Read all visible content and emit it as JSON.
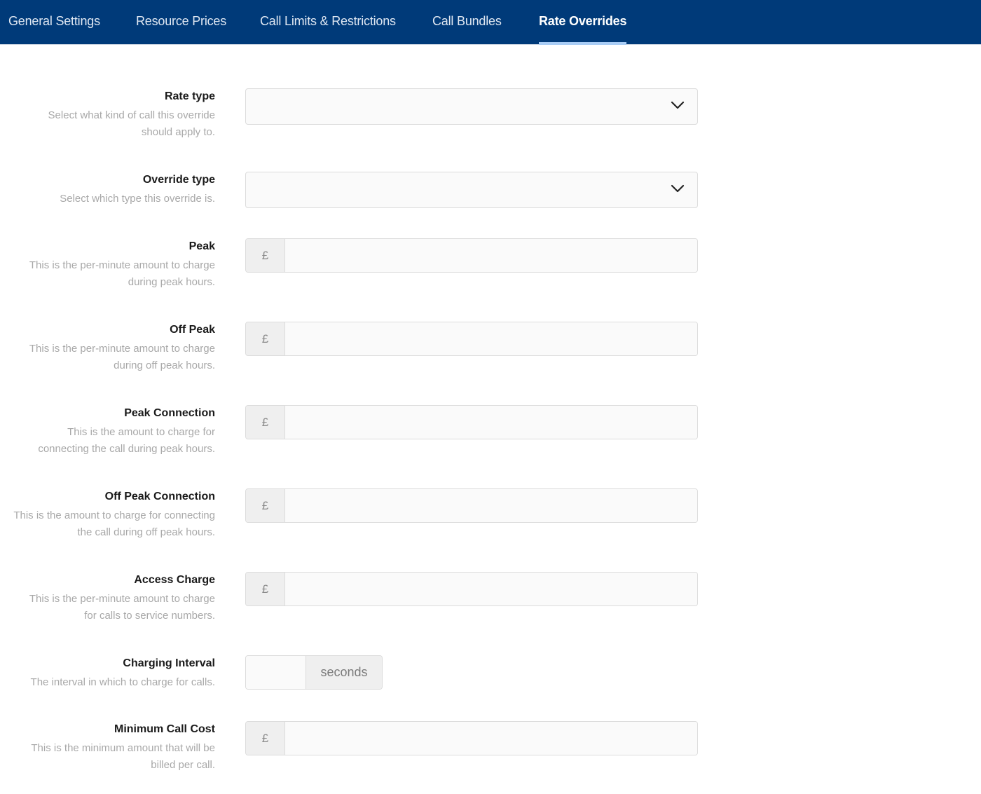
{
  "nav": {
    "tabs": [
      {
        "label": "General Settings",
        "active": false
      },
      {
        "label": "Resource Prices",
        "active": false
      },
      {
        "label": "Call Limits & Restrictions",
        "active": false
      },
      {
        "label": "Call Bundles",
        "active": false
      },
      {
        "label": "Rate Overrides",
        "active": true
      }
    ]
  },
  "colors": {
    "navbar_bg": "#003a79",
    "active_tab_indicator": "#a9cdf6",
    "label_text": "#1a1a1a",
    "description_text": "#a8a8a8"
  },
  "form": {
    "rate_type": {
      "label": "Rate type",
      "description": "Select what kind of call this override should apply to.",
      "value": "",
      "icon": "chevron-down-icon"
    },
    "override_type": {
      "label": "Override type",
      "description": "Select which type this override is.",
      "value": "",
      "icon": "chevron-down-icon"
    },
    "peak": {
      "label": "Peak",
      "description": "This is the per-minute amount to charge during peak hours.",
      "prefix": "£",
      "value": ""
    },
    "off_peak": {
      "label": "Off Peak",
      "description": "This is the per-minute amount to charge during off peak hours.",
      "prefix": "£",
      "value": ""
    },
    "peak_connection": {
      "label": "Peak Connection",
      "description": "This is the amount to charge for connecting the call during peak hours.",
      "prefix": "£",
      "value": ""
    },
    "off_peak_connection": {
      "label": "Off Peak Connection",
      "description": "This is the amount to charge for connecting the call during off peak hours.",
      "prefix": "£",
      "value": ""
    },
    "access_charge": {
      "label": "Access Charge",
      "description": "This is the per-minute amount to charge for calls to service numbers.",
      "prefix": "£",
      "value": ""
    },
    "charging_interval": {
      "label": "Charging Interval",
      "description": "The interval in which to charge for calls.",
      "suffix": "seconds",
      "value": ""
    },
    "minimum_call_cost": {
      "label": "Minimum Call Cost",
      "description": "This is the minimum amount that will be billed per call.",
      "prefix": "£",
      "value": ""
    }
  }
}
